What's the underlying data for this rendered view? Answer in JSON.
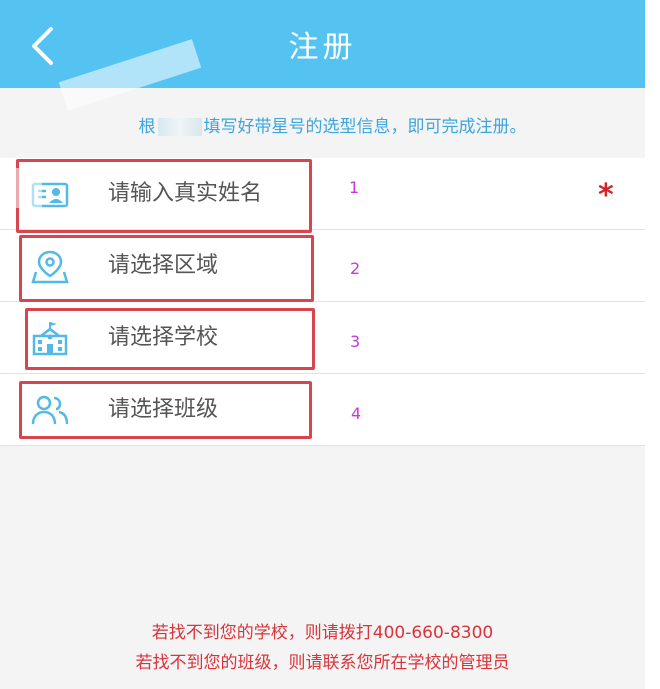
{
  "header": {
    "title": "注册",
    "back_icon": "chevron-left-icon"
  },
  "hint": {
    "text_before": "根",
    "text_after": "填写好带星号的选型信息，即可完成注册。"
  },
  "form": {
    "rows": [
      {
        "label": "请输入真实姓名",
        "icon": "id-card-icon",
        "number": "1",
        "required_mark": "*"
      },
      {
        "label": "请选择区域",
        "icon": "location-pin-icon",
        "number": "2"
      },
      {
        "label": "请选择学校",
        "icon": "school-building-icon",
        "number": "3"
      },
      {
        "label": "请选择班级",
        "icon": "users-icon",
        "number": "4"
      }
    ]
  },
  "footer": {
    "line1": "若找不到您的学校，则请拨打400-660-8300",
    "line2": "若找不到您的班级，则请联系您所在学校的管理员"
  },
  "colors": {
    "header_bg": "#55c3f2",
    "hint_text": "#3da6db",
    "icon": "#52b9e8",
    "highlight_box": "#d9454e",
    "annotation_number": "#c73ad9",
    "required_star": "#d2242b",
    "footer_text": "#d8343a"
  }
}
